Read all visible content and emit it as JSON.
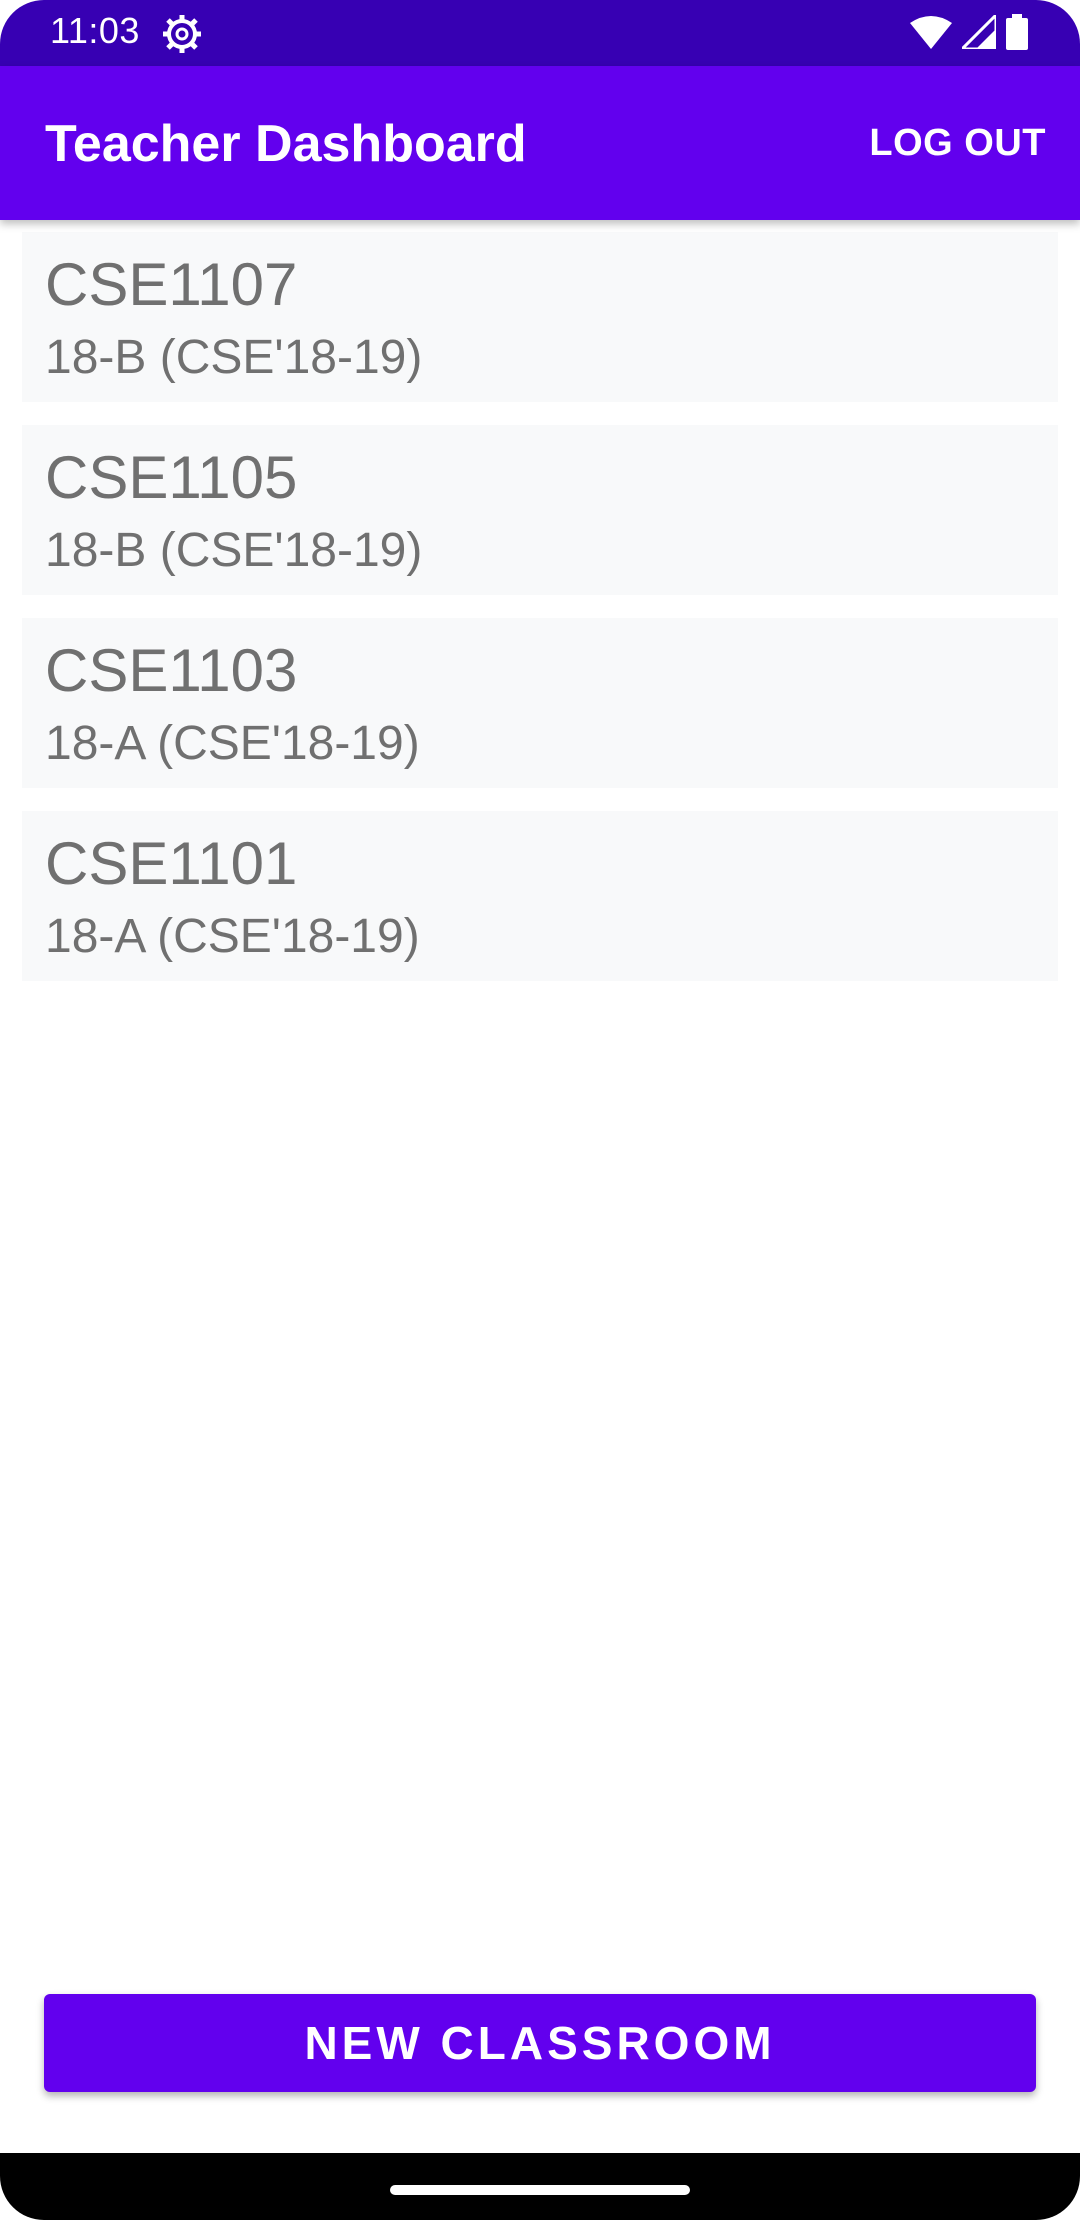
{
  "status_bar": {
    "time": "11:03",
    "icons": [
      "gear-icon",
      "wifi-icon",
      "signal-icon",
      "battery-icon"
    ]
  },
  "app_bar": {
    "title": "Teacher Dashboard",
    "logout_label": "LOG OUT",
    "color": "#6200ee"
  },
  "courses": [
    {
      "code": "CSE1107",
      "section": "18-B (CSE'18-19)"
    },
    {
      "code": "CSE1105",
      "section": "18-B (CSE'18-19)"
    },
    {
      "code": "CSE1103",
      "section": "18-A (CSE'18-19)"
    },
    {
      "code": "CSE1101",
      "section": "18-A (CSE'18-19)"
    }
  ],
  "actions": {
    "new_classroom_label": "NEW CLASSROOM"
  },
  "colors": {
    "primary": "#6200ee",
    "status_bar": "#3700b3",
    "card_background": "#f8f9fa",
    "card_text": "#707070"
  }
}
